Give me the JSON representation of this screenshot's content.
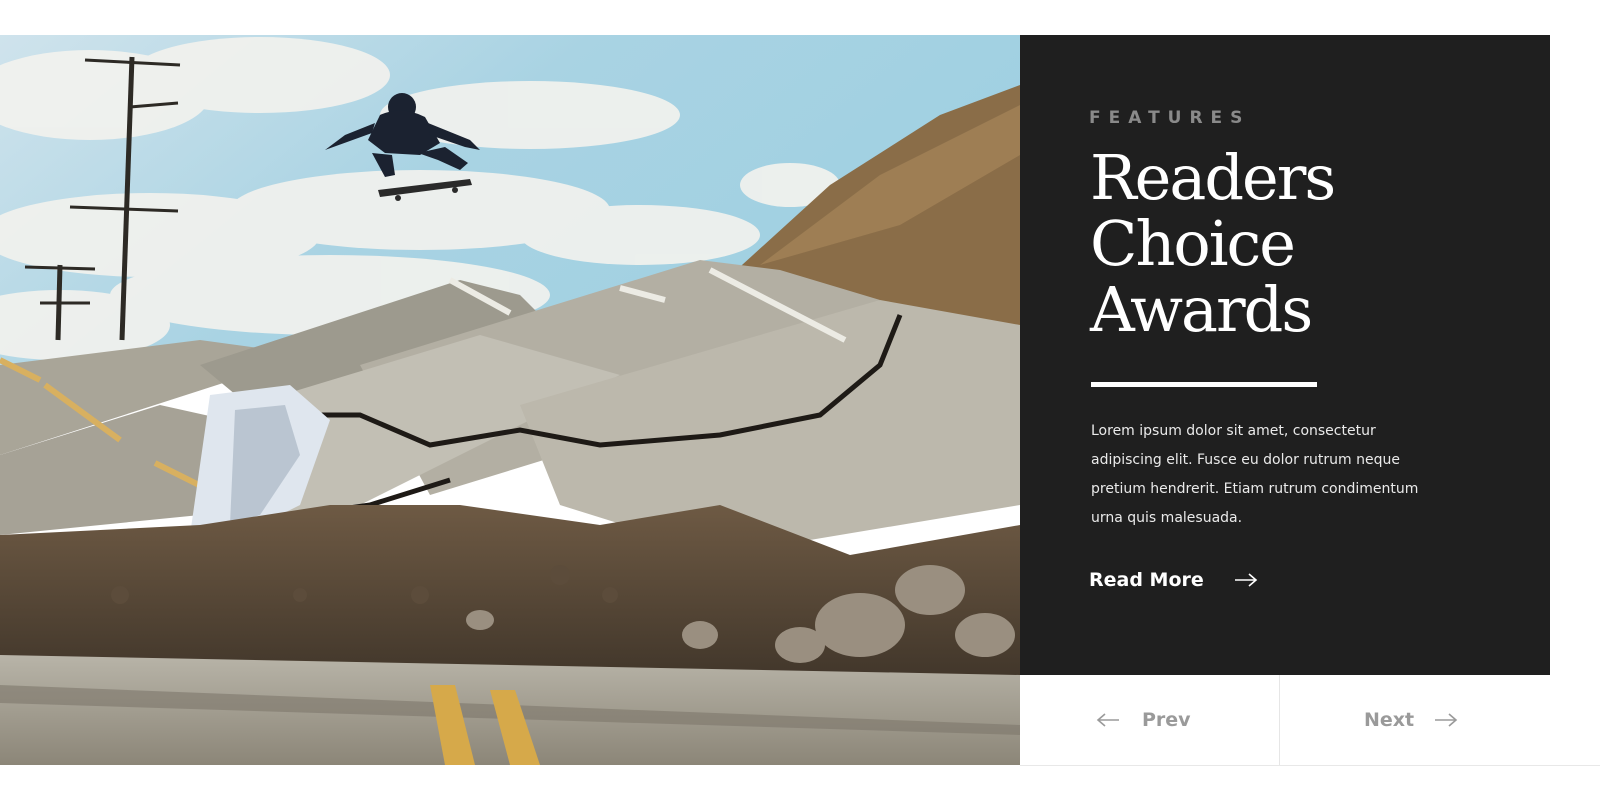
{
  "hero": {
    "image_description_icon": "skateboarder-photo"
  },
  "feature": {
    "eyebrow": "FEATURES",
    "title": "Readers Choice Awards",
    "body": "Lorem ipsum dolor sit amet, consectetur adipiscing elit. Fusce eu dolor rutrum neque pretium hendrerit. Etiam rutrum condimentum urna quis malesuada.",
    "read_more_label": "Read More",
    "read_more_icon": "arrow-right-icon"
  },
  "pager": {
    "prev_label": "Prev",
    "prev_icon": "arrow-left-icon",
    "next_label": "Next",
    "next_icon": "arrow-right-icon"
  },
  "colors": {
    "panel_bg": "#1f1f1f",
    "eyebrow": "#8a8a8a",
    "nav_text": "#9a9a9a"
  }
}
